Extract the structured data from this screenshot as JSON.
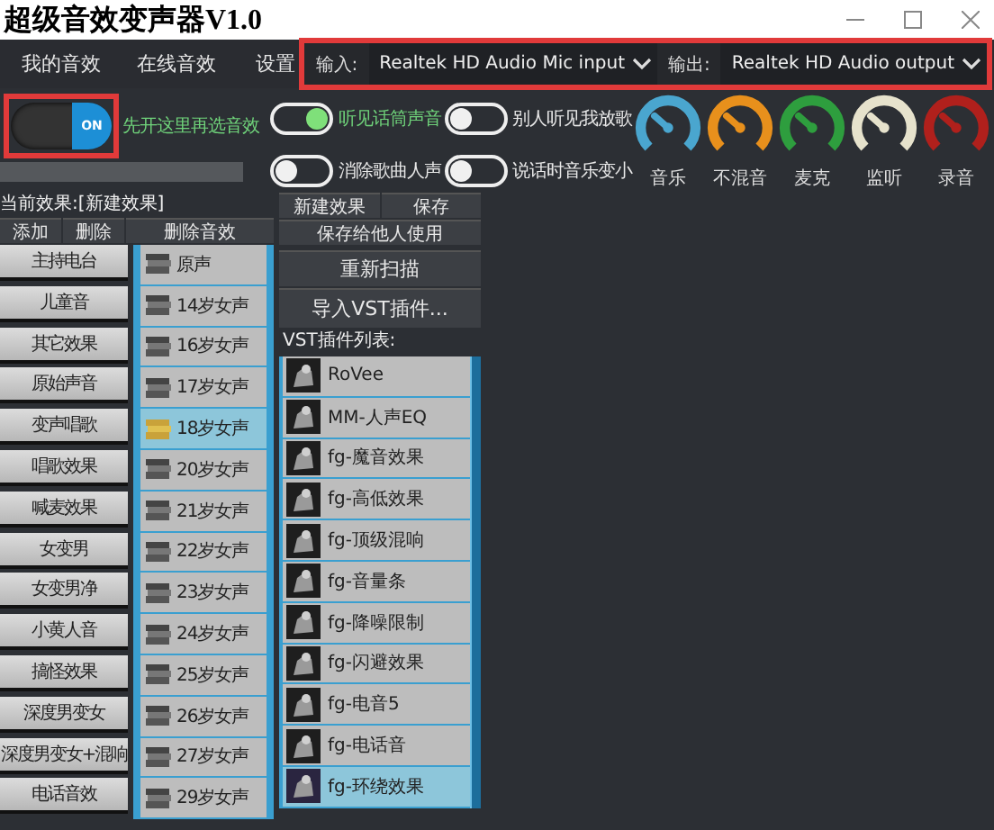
{
  "window": {
    "title": "超级音效变声器V1.0"
  },
  "tabs": [
    {
      "label": "我的音效",
      "selected": false
    },
    {
      "label": "在线音效",
      "selected": false
    },
    {
      "label": "设置",
      "selected": false
    }
  ],
  "devices": [
    {
      "label": "输入:",
      "value": "Realtek HD Audio Mic input"
    },
    {
      "label": "输出:",
      "value": "Realtek HD Audio output"
    }
  ],
  "master_switch": {
    "on": true,
    "label": "ON",
    "hint": "先开这里再选音效"
  },
  "switches": [
    {
      "label": "听见话筒声音",
      "on": true
    },
    {
      "label": "别人听见我放歌",
      "on": false
    },
    {
      "label": "消除歌曲人声",
      "on": false
    },
    {
      "label": "说话时音乐变小",
      "on": false
    }
  ],
  "knobs": [
    {
      "label": "音乐",
      "color": "#4aa6cf"
    },
    {
      "label": "不混音",
      "color": "#e8901c"
    },
    {
      "label": "麦克",
      "color": "#2e9e3e"
    },
    {
      "label": "监听",
      "color": "#e6e2cc"
    },
    {
      "label": "录音",
      "color": "#b0201c"
    }
  ],
  "current_effect": "当前效果:[新建效果]",
  "effect_buttons": [
    "添加",
    "删除",
    "删除音效"
  ],
  "preset_buttons": [
    "新建效果",
    "保存"
  ],
  "share_button": "保存给他人使用",
  "rescan_button": "重新扫描",
  "import_button": "导入VST插件...",
  "categories": [
    "主持电台",
    "儿童音",
    "其它效果",
    "原始声音",
    "变声唱歌",
    "唱歌效果",
    "喊麦效果",
    "女变男",
    "女变男净",
    "小黄人音",
    "搞怪效果",
    "深度男变女",
    "深度男变女+混响",
    "电话音效"
  ],
  "voices": [
    {
      "label": "原声",
      "selected": false
    },
    {
      "label": "14岁女声",
      "selected": false
    },
    {
      "label": "16岁女声",
      "selected": false
    },
    {
      "label": "17岁女声",
      "selected": false
    },
    {
      "label": "18岁女声",
      "selected": true
    },
    {
      "label": "20岁女声",
      "selected": false
    },
    {
      "label": "21岁女声",
      "selected": false
    },
    {
      "label": "22岁女声",
      "selected": false
    },
    {
      "label": "23岁女声",
      "selected": false
    },
    {
      "label": "24岁女声",
      "selected": false
    },
    {
      "label": "25岁女声",
      "selected": false
    },
    {
      "label": "26岁女声",
      "selected": false
    },
    {
      "label": "27岁女声",
      "selected": false
    },
    {
      "label": "29岁女声",
      "selected": false
    }
  ],
  "vst_list": {
    "title": "VST插件列表:",
    "items": [
      {
        "label": "RoVee",
        "selected": false
      },
      {
        "label": "MM-人声EQ",
        "selected": false
      },
      {
        "label": "fg-魔音效果",
        "selected": false
      },
      {
        "label": "fg-高低效果",
        "selected": false
      },
      {
        "label": "fg-顶级混响",
        "selected": false
      },
      {
        "label": "fg-音量条",
        "selected": false
      },
      {
        "label": "fg-降噪限制",
        "selected": false
      },
      {
        "label": "fg-闪避效果",
        "selected": false
      },
      {
        "label": "fg-电音5",
        "selected": false
      },
      {
        "label": "fg-电话音",
        "selected": false
      },
      {
        "label": "fg-环绕效果",
        "selected": true
      }
    ]
  }
}
